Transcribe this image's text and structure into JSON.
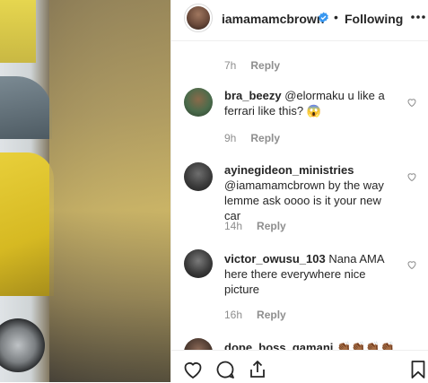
{
  "post": {
    "author": "iamamamcbrown",
    "separator": "•",
    "follow_state": "Following"
  },
  "comments": [
    {
      "time": "7h",
      "reply_label": "Reply"
    },
    {
      "username": "bra_beezy",
      "text": "@elormaku u like a ferrari like this? 😱",
      "time": "9h",
      "reply_label": "Reply"
    },
    {
      "username": "ayinegideon_ministries",
      "text": "@iamamamcbrown by the way lemme ask oooo is it your new car",
      "time": "14h",
      "reply_label": "Reply"
    },
    {
      "username": "victor_owusu_103",
      "text": "Nana AMA here there everywhere nice picture",
      "time": "16h",
      "reply_label": "Reply"
    },
    {
      "username": "dope_boss_gamani",
      "text": "👏🏾👏🏾👏🏾👏🏾"
    }
  ],
  "icons": {
    "like": "heart-icon",
    "comment": "comment-icon",
    "share": "share-icon",
    "save": "bookmark-icon",
    "more": "more-icon",
    "verified": "verified-badge-icon"
  },
  "colors": {
    "accent": "#3897f0",
    "muted": "#8e8e8e",
    "text": "#262626",
    "border": "#efefef"
  }
}
